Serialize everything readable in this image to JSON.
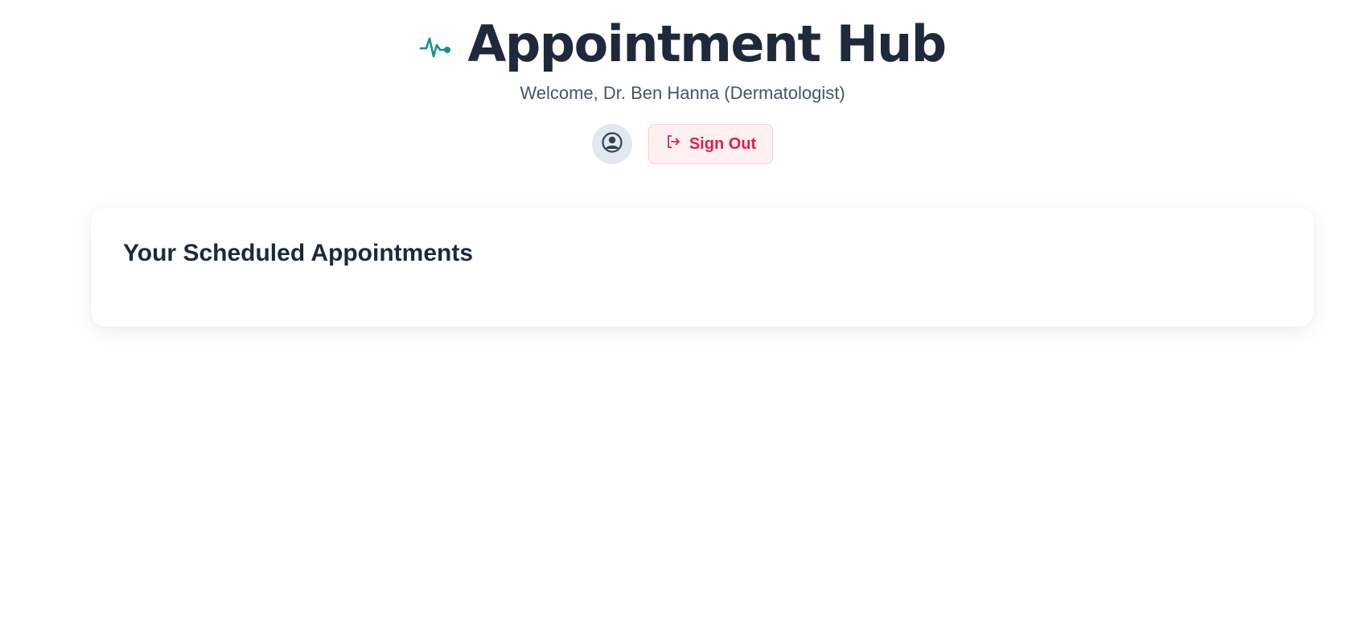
{
  "header": {
    "title": "Appointment Hub",
    "welcome": "Welcome, Dr. Ben Hanna (Dermatologist)",
    "logo_icon": "heartbeat-pulse-icon",
    "accent_color": "#0d9488"
  },
  "actions": {
    "profile_icon": "user-circle-icon",
    "signout_icon": "logout-icon",
    "signout_label": "Sign Out",
    "signout_color": "#e11d48"
  },
  "appointments": {
    "heading": "Your Scheduled Appointments"
  }
}
